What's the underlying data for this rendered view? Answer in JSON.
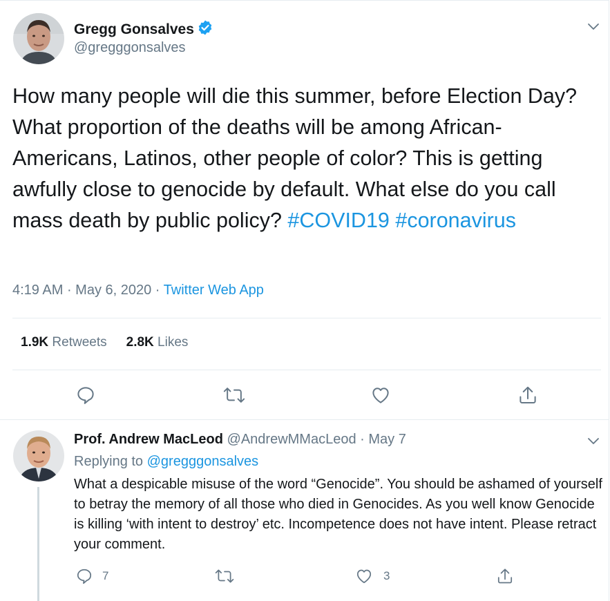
{
  "tweet": {
    "author_name": "Gregg Gonsalves",
    "author_handle": "@gregggonsalves",
    "text_plain": "How many people will die this summer, before Election Day? What proportion of the deaths will be among African-Americans, Latinos, other people of color? This is getting awfully close to genocide by default. What else do you call mass death by public policy? ",
    "hashtag_1": "#COVID19",
    "hashtag_2": "#coronavirus",
    "time": "4:19 AM",
    "sep_1": " · ",
    "date": "May 6, 2020",
    "sep_2": " · ",
    "source": "Twitter Web App",
    "retweets_count": "1.9K",
    "retweets_label": "Retweets",
    "likes_count": "2.8K",
    "likes_label": "Likes"
  },
  "reply": {
    "author_name": "Prof. Andrew MacLeod",
    "author_handle": "@AndrewMMacLeod",
    "separator": " · ",
    "date": "May 7",
    "replying_prefix": "Replying to ",
    "replying_to": "@gregggonsalves",
    "text": "What a despicable misuse of the word “Genocide”. You should be ashamed of yourself to betray the memory of all those who died in Genocides. As you well know Genocide is killing ‘with intent to destroy’ etc. Incompetence does not have intent. Please retract your comment.",
    "reply_count": "7",
    "like_count": "3"
  },
  "icons": {
    "verified": "verified-badge-icon",
    "menu": "chevron-down-icon",
    "reply": "reply-bubble-icon",
    "retweet": "retweet-icon",
    "like": "heart-icon",
    "share": "share-icon"
  },
  "colors": {
    "link": "#1b95e0",
    "secondary_text": "#657786",
    "primary_text": "#14171a",
    "divider": "#e6ecf0"
  }
}
